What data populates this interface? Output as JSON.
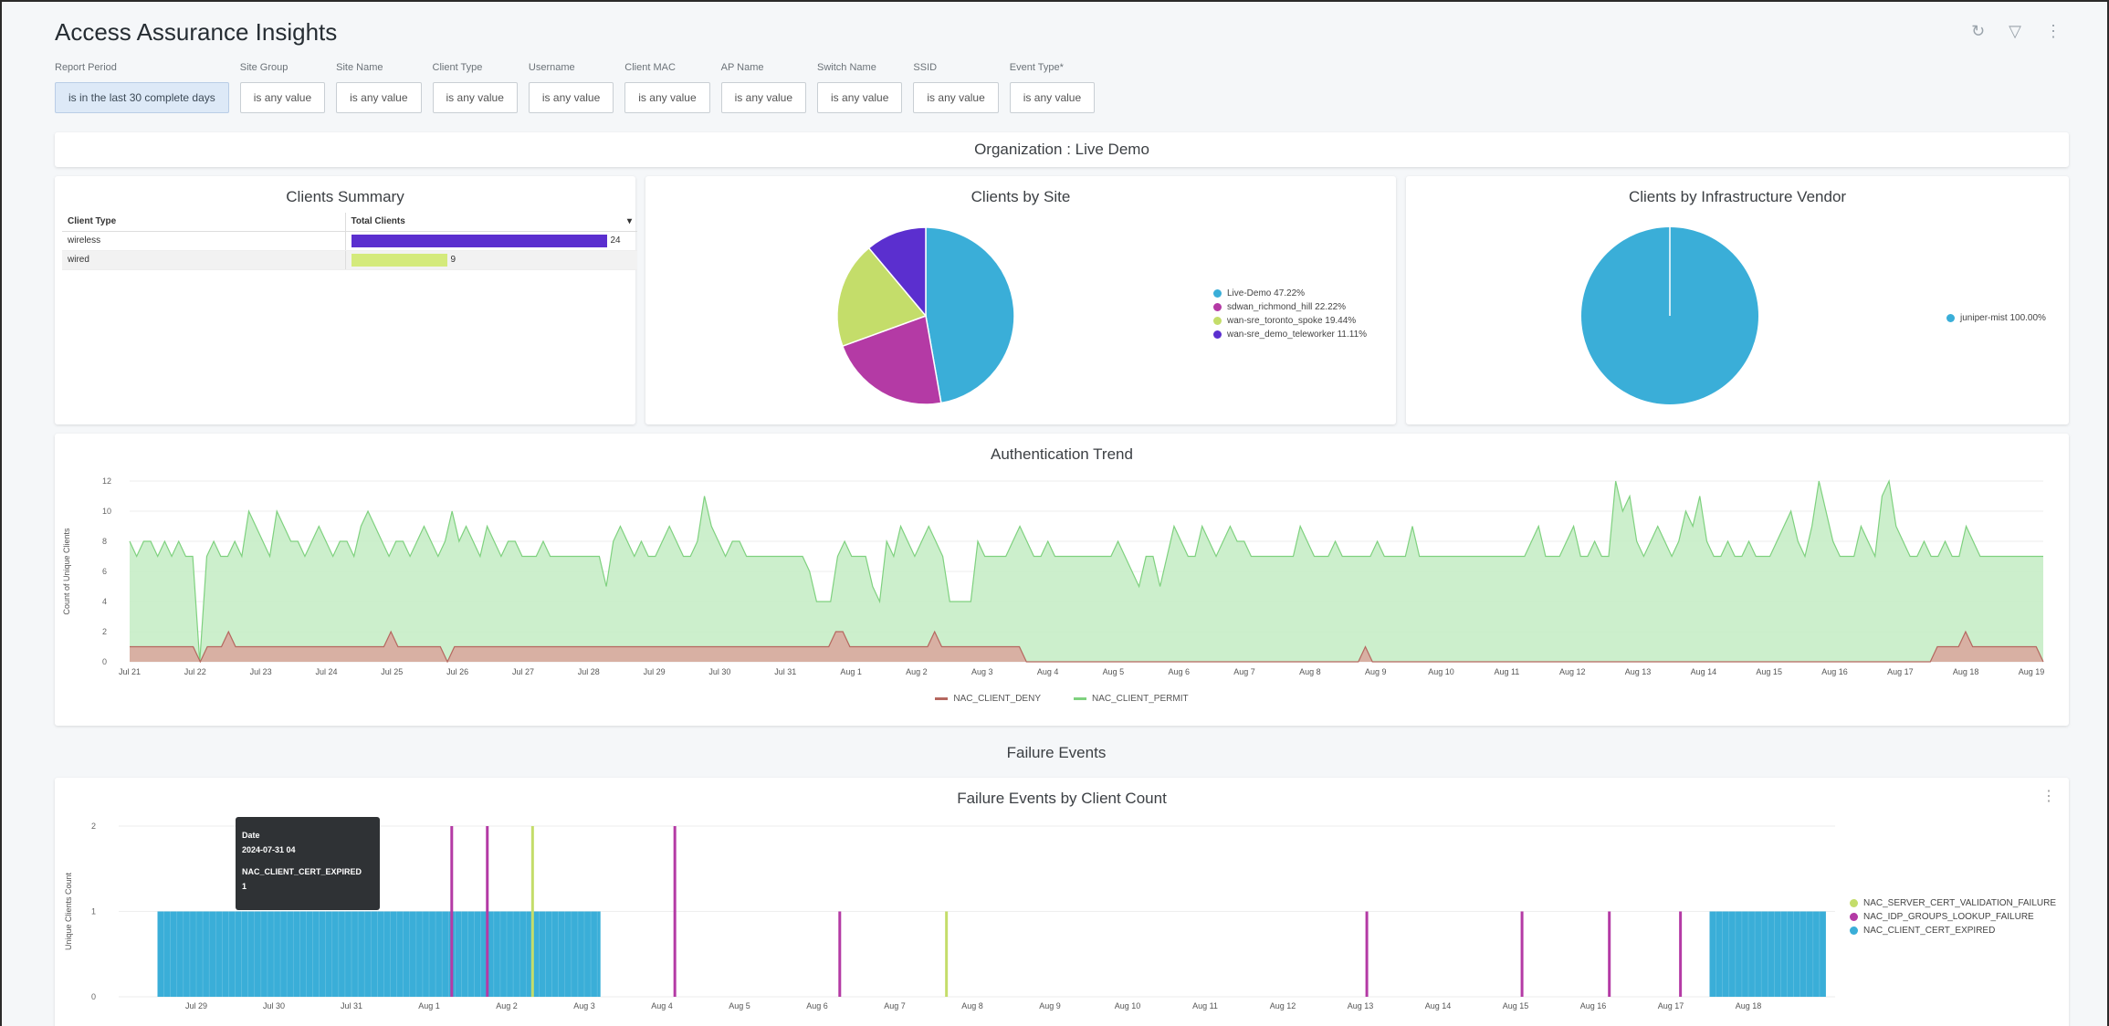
{
  "header": {
    "title": "Access Assurance Insights",
    "icons": [
      "refresh-icon",
      "filter-icon",
      "more-vertical-icon"
    ]
  },
  "filters": [
    {
      "label": "Report Period",
      "value": "is in the last 30 complete days",
      "selected": true
    },
    {
      "label": "Site Group",
      "value": "is any value"
    },
    {
      "label": "Site Name",
      "value": "is any value"
    },
    {
      "label": "Client Type",
      "value": "is any value"
    },
    {
      "label": "Username",
      "value": "is any value"
    },
    {
      "label": "Client MAC",
      "value": "is any value"
    },
    {
      "label": "AP Name",
      "value": "is any value"
    },
    {
      "label": "Switch Name",
      "value": "is any value"
    },
    {
      "label": "SSID",
      "value": "is any value"
    },
    {
      "label": "Event Type*",
      "value": "is any value"
    }
  ],
  "org_banner": "Organization : Live Demo",
  "clients_summary": {
    "title": "Clients Summary",
    "col1": "Client Type",
    "col2": "Total Clients",
    "sort_icon": "sort-icon",
    "rows": [
      {
        "type": "wireless",
        "count": "24",
        "value": 24,
        "color": "#5b2fcf"
      },
      {
        "type": "wired",
        "count": "9",
        "value": 9,
        "color": "#d4ea7c"
      }
    ]
  },
  "clients_by_site": {
    "title": "Clients by Site",
    "legend": [
      "Live-Demo 47.22%",
      "sdwan_richmond_hill 22.22%",
      "wan-sre_toronto_spoke 19.44%",
      "wan-sre_demo_teleworker 11.11%"
    ]
  },
  "clients_by_vendor": {
    "title": "Clients by Infrastructure Vendor",
    "legend": [
      "juniper-mist 100.00%"
    ]
  },
  "auth_trend": {
    "title": "Authentication Trend",
    "legend_deny": "NAC_CLIENT_DENY",
    "legend_permit": "NAC_CLIENT_PERMIT"
  },
  "failure_section_title": "Failure Events",
  "failure_events": {
    "title": "Failure Events by Client Count",
    "legend": [
      "NAC_SERVER_CERT_VALIDATION_FAILURE",
      "NAC_IDP_GROUPS_LOOKUP_FAILURE",
      "NAC_CLIENT_CERT_EXPIRED"
    ],
    "more_icon": "more-vertical-icon"
  },
  "tooltip": {
    "l1": "Date",
    "l2": "2024-07-31 04",
    "l3": "NAC_CLIENT_CERT_EXPIRED",
    "l4": "1"
  },
  "chart_data": [
    {
      "type": "pie",
      "title": "Clients by Site",
      "categories": [
        "Live-Demo",
        "sdwan_richmond_hill",
        "wan-sre_toronto_spoke",
        "wan-sre_demo_teleworker"
      ],
      "values": [
        47.22,
        22.22,
        19.44,
        11.11
      ],
      "colors": [
        "#3aaed8",
        "#b43aa5",
        "#c4dd6a",
        "#5b2fcf"
      ],
      "legend_position": "right"
    },
    {
      "type": "pie",
      "title": "Clients by Infrastructure Vendor",
      "categories": [
        "juniper-mist"
      ],
      "values": [
        100.0
      ],
      "colors": [
        "#3aaed8"
      ],
      "legend_position": "right"
    },
    {
      "type": "area",
      "title": "Authentication Trend",
      "ylabel": "Count of Unique Clients",
      "ylim": [
        0,
        12
      ],
      "yticks": [
        0,
        2,
        4,
        6,
        8,
        10,
        12
      ],
      "x_start": "2024-07-21",
      "x_end": "2024-08-19",
      "xtick_labels": [
        "Jul 21",
        "Jul 22",
        "Jul 23",
        "Jul 24",
        "Jul 25",
        "Jul 26",
        "Jul 27",
        "Jul 28",
        "Jul 29",
        "Jul 30",
        "Jul 31",
        "Aug 1",
        "Aug 2",
        "Aug 3",
        "Aug 4",
        "Aug 5",
        "Aug 6",
        "Aug 7",
        "Aug 8",
        "Aug 9",
        "Aug 10",
        "Aug 11",
        "Aug 12",
        "Aug 13",
        "Aug 14",
        "Aug 15",
        "Aug 16",
        "Aug 17",
        "Aug 18",
        "Aug 19"
      ],
      "grid": true,
      "legend_position": "bottom",
      "series": [
        {
          "name": "NAC_CLIENT_PERMIT",
          "color": "#7fd17f",
          "fill": "#c6edc6",
          "values": [
            8,
            7,
            8,
            8,
            7,
            8,
            7,
            8,
            7,
            7,
            0,
            7,
            8,
            7,
            7,
            8,
            7,
            10,
            9,
            8,
            7,
            10,
            9,
            8,
            8,
            7,
            8,
            9,
            8,
            7,
            8,
            8,
            7,
            9,
            10,
            9,
            8,
            7,
            8,
            8,
            7,
            8,
            9,
            8,
            7,
            8,
            10,
            8,
            9,
            8,
            7,
            9,
            8,
            7,
            8,
            8,
            7,
            7,
            7,
            8,
            7,
            7,
            7,
            7,
            7,
            7,
            7,
            7,
            5,
            8,
            9,
            8,
            7,
            8,
            7,
            7,
            8,
            9,
            8,
            7,
            7,
            8,
            11,
            9,
            8,
            7,
            8,
            8,
            7,
            7,
            7,
            7,
            7,
            7,
            7,
            7,
            7,
            6,
            4,
            4,
            4,
            7,
            8,
            7,
            7,
            7,
            5,
            4,
            8,
            7,
            9,
            8,
            7,
            8,
            9,
            8,
            7,
            4,
            4,
            4,
            4,
            8,
            7,
            7,
            7,
            7,
            8,
            9,
            8,
            7,
            7,
            8,
            7,
            7,
            7,
            7,
            7,
            7,
            7,
            7,
            7,
            8,
            7,
            6,
            5,
            7,
            7,
            5,
            7,
            9,
            8,
            7,
            7,
            9,
            8,
            7,
            8,
            9,
            8,
            8,
            7,
            7,
            7,
            7,
            7,
            7,
            7,
            9,
            8,
            7,
            7,
            7,
            8,
            7,
            7,
            7,
            7,
            7,
            8,
            7,
            7,
            7,
            7,
            9,
            7,
            7,
            7,
            7,
            7,
            7,
            7,
            7,
            7,
            7,
            7,
            7,
            7,
            7,
            7,
            7,
            8,
            9,
            7,
            7,
            7,
            8,
            9,
            7,
            7,
            8,
            7,
            7,
            12,
            10,
            11,
            8,
            7,
            8,
            9,
            8,
            7,
            8,
            10,
            9,
            11,
            8,
            7,
            7,
            8,
            7,
            7,
            8,
            7,
            7,
            7,
            8,
            9,
            10,
            8,
            7,
            9,
            12,
            10,
            8,
            7,
            7,
            7,
            9,
            8,
            7,
            11,
            12,
            9,
            8,
            7,
            7,
            8,
            7,
            7,
            8,
            7,
            7,
            9,
            8,
            7,
            7,
            7,
            7,
            7,
            7,
            7,
            7,
            7,
            7
          ]
        },
        {
          "name": "NAC_CLIENT_DENY",
          "color": "#b5675f",
          "fill": "#d9a89e",
          "values": [
            1,
            1,
            1,
            1,
            1,
            1,
            1,
            1,
            1,
            1,
            0,
            1,
            1,
            1,
            2,
            1,
            1,
            1,
            1,
            1,
            1,
            1,
            1,
            1,
            1,
            1,
            1,
            1,
            1,
            1,
            1,
            1,
            1,
            1,
            1,
            1,
            1,
            2,
            1,
            1,
            1,
            1,
            1,
            1,
            1,
            0,
            1,
            1,
            1,
            1,
            1,
            1,
            1,
            1,
            1,
            1,
            1,
            1,
            1,
            1,
            1,
            1,
            1,
            1,
            1,
            1,
            1,
            1,
            1,
            1,
            1,
            1,
            1,
            1,
            1,
            1,
            1,
            1,
            1,
            1,
            1,
            1,
            1,
            1,
            1,
            1,
            1,
            1,
            1,
            1,
            1,
            1,
            1,
            1,
            1,
            1,
            1,
            1,
            1,
            1,
            2,
            2,
            1,
            1,
            1,
            1,
            1,
            1,
            1,
            1,
            1,
            1,
            1,
            1,
            2,
            1,
            1,
            1,
            1,
            1,
            1,
            1,
            1,
            1,
            1,
            1,
            1,
            0,
            0,
            0,
            0,
            0,
            0,
            0,
            0,
            0,
            0,
            0,
            0,
            0,
            0,
            0,
            0,
            0,
            0,
            0,
            0,
            0,
            0,
            0,
            0,
            0,
            0,
            0,
            0,
            0,
            0,
            0,
            0,
            0,
            0,
            0,
            0,
            0,
            0,
            0,
            0,
            0,
            0,
            0,
            0,
            0,
            0,
            0,
            0,
            1,
            0,
            0,
            0,
            0,
            0,
            0,
            0,
            0,
            0,
            0,
            0,
            0,
            0,
            0,
            0,
            0,
            0,
            0,
            0,
            0,
            0,
            0,
            0,
            0,
            0,
            0,
            0,
            0,
            0,
            0,
            0,
            0,
            0,
            0,
            0,
            0,
            0,
            0,
            0,
            0,
            0,
            0,
            0,
            0,
            0,
            0,
            0,
            0,
            0,
            0,
            0,
            0,
            0,
            0,
            0,
            0,
            0,
            0,
            0,
            0,
            0,
            0,
            0,
            0,
            0,
            0,
            0,
            0,
            0,
            0,
            0,
            0,
            0,
            0,
            0,
            0,
            0,
            0,
            0,
            0,
            1,
            1,
            1,
            1,
            2,
            1,
            1,
            1,
            1,
            1,
            1,
            1,
            1,
            1,
            1,
            0
          ]
        }
      ]
    },
    {
      "type": "bar",
      "title": "Failure Events by Client Count",
      "ylabel": "Unique Clients Count",
      "ylim": [
        0,
        2
      ],
      "yticks": [
        0,
        1,
        2
      ],
      "x_start": "2024-07-28",
      "x_end": "2024-08-19",
      "xtick_labels": [
        "Jul 29",
        "Jul 30",
        "Jul 31",
        "Aug 1",
        "Aug 2",
        "Aug 3",
        "Aug 4",
        "Aug 5",
        "Aug 6",
        "Aug 7",
        "Aug 8",
        "Aug 9",
        "Aug 10",
        "Aug 11",
        "Aug 12",
        "Aug 13",
        "Aug 14",
        "Aug 15",
        "Aug 16",
        "Aug 17",
        "Aug 18"
      ],
      "legend_position": "right",
      "series": [
        {
          "name": "NAC_CLIENT_CERT_EXPIRED",
          "color": "#3aaed8",
          "ranges": [
            {
              "from": "2024-07-28 12",
              "to": "2024-08-03 05",
              "value": 1
            },
            {
              "from": "2024-08-17 12",
              "to": "2024-08-19 00",
              "value": 1
            }
          ]
        },
        {
          "name": "NAC_IDP_GROUPS_LOOKUP_FAILURE",
          "color": "#b43aa5",
          "points": [
            {
              "x": "2024-08-01 07",
              "y": 2
            },
            {
              "x": "2024-08-01 18",
              "y": 2
            },
            {
              "x": "2024-08-04 04",
              "y": 2
            },
            {
              "x": "2024-08-06 07",
              "y": 1
            },
            {
              "x": "2024-08-13 02",
              "y": 1
            },
            {
              "x": "2024-08-15 02",
              "y": 1
            },
            {
              "x": "2024-08-16 05",
              "y": 1
            },
            {
              "x": "2024-08-17 03",
              "y": 1
            }
          ]
        },
        {
          "name": "NAC_SERVER_CERT_VALIDATION_FAILURE",
          "color": "#c4dd6a",
          "points": [
            {
              "x": "2024-08-02 08",
              "y": 2
            },
            {
              "x": "2024-08-07 16",
              "y": 1
            }
          ]
        }
      ]
    }
  ]
}
